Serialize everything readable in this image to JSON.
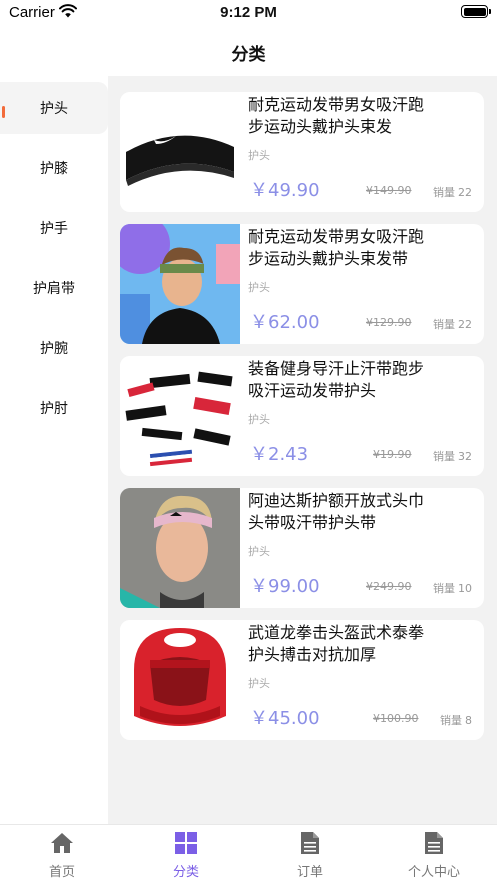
{
  "status_bar": {
    "carrier": "Carrier",
    "time": "9:12 PM"
  },
  "nav": {
    "title": "分类"
  },
  "sidebar": {
    "active_index": 0,
    "accent_color": "#f26b3a",
    "items": [
      {
        "label": "护头"
      },
      {
        "label": "护膝"
      },
      {
        "label": "护手"
      },
      {
        "label": "护肩带"
      },
      {
        "label": "护腕"
      },
      {
        "label": "护肘"
      }
    ]
  },
  "products": [
    {
      "name": "耐克运动发带男女吸汗跑步运动头戴护头束发",
      "category": "护头",
      "price": "￥49.90",
      "original_price": "¥149.90",
      "sales_label": "销量",
      "sales": "22"
    },
    {
      "name": "耐克运动发带男女吸汗跑步运动头戴护头束发带",
      "category": "护头",
      "price": "￥62.00",
      "original_price": "¥129.90",
      "sales_label": "销量",
      "sales": "22"
    },
    {
      "name": "装备健身导汗止汗带跑步吸汗运动发带护头",
      "category": "护头",
      "price": "￥2.43",
      "original_price": "¥19.90",
      "sales_label": "销量",
      "sales": "32"
    },
    {
      "name": "阿迪达斯护额开放式头巾头带吸汗带护头带",
      "category": "护头",
      "price": "￥99.00",
      "original_price": "¥249.90",
      "sales_label": "销量",
      "sales": "10"
    },
    {
      "name": "武道龙拳击头盔武术泰拳护头搏击对抗加厚",
      "category": "护头",
      "price": "￥45.00",
      "original_price": "¥100.90",
      "sales_label": "销量",
      "sales": "8"
    }
  ],
  "price_color": "#8b8fe6",
  "tab_bar": {
    "active_index": 1,
    "active_color": "#7b5fe6",
    "tabs": [
      {
        "label": "首页",
        "icon": "home-icon"
      },
      {
        "label": "分类",
        "icon": "grid-icon"
      },
      {
        "label": "订单",
        "icon": "document-icon"
      },
      {
        "label": "个人中心",
        "icon": "document-icon"
      }
    ]
  }
}
